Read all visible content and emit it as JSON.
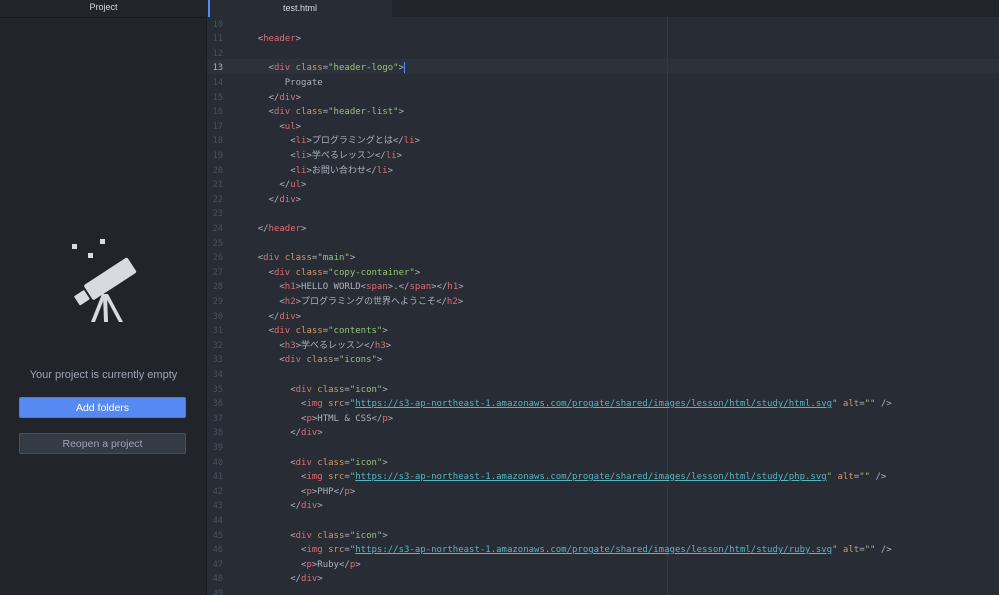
{
  "sidebar": {
    "title": "Project",
    "empty_message": "Your project is currently empty",
    "add_folders_label": "Add folders",
    "reopen_label": "Reopen a project"
  },
  "tabs": [
    {
      "label": "test.html",
      "active": true
    }
  ],
  "editor": {
    "cursor_line": 13,
    "lines": [
      {
        "n": "10",
        "tokens": []
      },
      {
        "n": "11",
        "tokens": [
          {
            "t": "x",
            "v": "    "
          },
          {
            "t": "p",
            "v": "<"
          },
          {
            "t": "t",
            "v": "header"
          },
          {
            "t": "p",
            "v": ">"
          }
        ]
      },
      {
        "n": "12",
        "tokens": []
      },
      {
        "n": "13",
        "tokens": [
          {
            "t": "x",
            "v": "      "
          },
          {
            "t": "p",
            "v": "<"
          },
          {
            "t": "t",
            "v": "div"
          },
          {
            "t": "x",
            "v": " "
          },
          {
            "t": "a",
            "v": "class"
          },
          {
            "t": "p",
            "v": "="
          },
          {
            "t": "s",
            "v": "\"header-logo\""
          },
          {
            "t": "p",
            "v": ">"
          }
        ]
      },
      {
        "n": "14",
        "tokens": [
          {
            "t": "x",
            "v": "         Progate"
          }
        ]
      },
      {
        "n": "15",
        "tokens": [
          {
            "t": "x",
            "v": "      "
          },
          {
            "t": "p",
            "v": "</"
          },
          {
            "t": "t",
            "v": "div"
          },
          {
            "t": "p",
            "v": ">"
          }
        ]
      },
      {
        "n": "16",
        "tokens": [
          {
            "t": "x",
            "v": "      "
          },
          {
            "t": "p",
            "v": "<"
          },
          {
            "t": "t",
            "v": "div"
          },
          {
            "t": "x",
            "v": " "
          },
          {
            "t": "a",
            "v": "class"
          },
          {
            "t": "p",
            "v": "="
          },
          {
            "t": "s",
            "v": "\"header-list\""
          },
          {
            "t": "p",
            "v": ">"
          }
        ]
      },
      {
        "n": "17",
        "tokens": [
          {
            "t": "x",
            "v": "        "
          },
          {
            "t": "p",
            "v": "<"
          },
          {
            "t": "t",
            "v": "ul"
          },
          {
            "t": "p",
            "v": ">"
          }
        ]
      },
      {
        "n": "18",
        "tokens": [
          {
            "t": "x",
            "v": "          "
          },
          {
            "t": "p",
            "v": "<"
          },
          {
            "t": "t",
            "v": "li"
          },
          {
            "t": "p",
            "v": ">"
          },
          {
            "t": "x",
            "v": "プログラミングとは"
          },
          {
            "t": "p",
            "v": "</"
          },
          {
            "t": "t",
            "v": "li"
          },
          {
            "t": "p",
            "v": ">"
          }
        ]
      },
      {
        "n": "19",
        "tokens": [
          {
            "t": "x",
            "v": "          "
          },
          {
            "t": "p",
            "v": "<"
          },
          {
            "t": "t",
            "v": "li"
          },
          {
            "t": "p",
            "v": ">"
          },
          {
            "t": "x",
            "v": "学べるレッスン"
          },
          {
            "t": "p",
            "v": "</"
          },
          {
            "t": "t",
            "v": "li"
          },
          {
            "t": "p",
            "v": ">"
          }
        ]
      },
      {
        "n": "20",
        "tokens": [
          {
            "t": "x",
            "v": "          "
          },
          {
            "t": "p",
            "v": "<"
          },
          {
            "t": "t",
            "v": "li"
          },
          {
            "t": "p",
            "v": ">"
          },
          {
            "t": "x",
            "v": "お問い合わせ"
          },
          {
            "t": "p",
            "v": "</"
          },
          {
            "t": "t",
            "v": "li"
          },
          {
            "t": "p",
            "v": ">"
          }
        ]
      },
      {
        "n": "21",
        "tokens": [
          {
            "t": "x",
            "v": "        "
          },
          {
            "t": "p",
            "v": "</"
          },
          {
            "t": "t",
            "v": "ul"
          },
          {
            "t": "p",
            "v": ">"
          }
        ]
      },
      {
        "n": "22",
        "tokens": [
          {
            "t": "x",
            "v": "      "
          },
          {
            "t": "p",
            "v": "</"
          },
          {
            "t": "t",
            "v": "div"
          },
          {
            "t": "p",
            "v": ">"
          }
        ]
      },
      {
        "n": "23",
        "tokens": []
      },
      {
        "n": "24",
        "tokens": [
          {
            "t": "x",
            "v": "    "
          },
          {
            "t": "p",
            "v": "</"
          },
          {
            "t": "t",
            "v": "header"
          },
          {
            "t": "p",
            "v": ">"
          }
        ]
      },
      {
        "n": "25",
        "tokens": []
      },
      {
        "n": "26",
        "tokens": [
          {
            "t": "x",
            "v": "    "
          },
          {
            "t": "p",
            "v": "<"
          },
          {
            "t": "t",
            "v": "div"
          },
          {
            "t": "x",
            "v": " "
          },
          {
            "t": "a",
            "v": "class"
          },
          {
            "t": "p",
            "v": "="
          },
          {
            "t": "s",
            "v": "\"main\""
          },
          {
            "t": "p",
            "v": ">"
          }
        ]
      },
      {
        "n": "27",
        "tokens": [
          {
            "t": "x",
            "v": "      "
          },
          {
            "t": "p",
            "v": "<"
          },
          {
            "t": "t",
            "v": "div"
          },
          {
            "t": "x",
            "v": " "
          },
          {
            "t": "a",
            "v": "class"
          },
          {
            "t": "p",
            "v": "="
          },
          {
            "t": "s",
            "v": "\"copy-container\""
          },
          {
            "t": "p",
            "v": ">"
          }
        ]
      },
      {
        "n": "28",
        "tokens": [
          {
            "t": "x",
            "v": "        "
          },
          {
            "t": "p",
            "v": "<"
          },
          {
            "t": "t",
            "v": "h1"
          },
          {
            "t": "p",
            "v": ">"
          },
          {
            "t": "x",
            "v": "HELLO WORLD"
          },
          {
            "t": "p",
            "v": "<"
          },
          {
            "t": "t",
            "v": "span"
          },
          {
            "t": "p",
            "v": ">"
          },
          {
            "t": "x",
            "v": "."
          },
          {
            "t": "p",
            "v": "</"
          },
          {
            "t": "t",
            "v": "span"
          },
          {
            "t": "p",
            "v": "></"
          },
          {
            "t": "t",
            "v": "h1"
          },
          {
            "t": "p",
            "v": ">"
          }
        ]
      },
      {
        "n": "29",
        "tokens": [
          {
            "t": "x",
            "v": "        "
          },
          {
            "t": "p",
            "v": "<"
          },
          {
            "t": "t",
            "v": "h2"
          },
          {
            "t": "p",
            "v": ">"
          },
          {
            "t": "x",
            "v": "プログラミングの世界へようこそ"
          },
          {
            "t": "p",
            "v": "</"
          },
          {
            "t": "t",
            "v": "h2"
          },
          {
            "t": "p",
            "v": ">"
          }
        ]
      },
      {
        "n": "30",
        "tokens": [
          {
            "t": "x",
            "v": "      "
          },
          {
            "t": "p",
            "v": "</"
          },
          {
            "t": "t",
            "v": "div"
          },
          {
            "t": "p",
            "v": ">"
          }
        ]
      },
      {
        "n": "31",
        "tokens": [
          {
            "t": "x",
            "v": "      "
          },
          {
            "t": "p",
            "v": "<"
          },
          {
            "t": "t",
            "v": "div"
          },
          {
            "t": "x",
            "v": " "
          },
          {
            "t": "a",
            "v": "class"
          },
          {
            "t": "p",
            "v": "="
          },
          {
            "t": "s",
            "v": "\"contents\""
          },
          {
            "t": "p",
            "v": ">"
          }
        ]
      },
      {
        "n": "32",
        "tokens": [
          {
            "t": "x",
            "v": "        "
          },
          {
            "t": "p",
            "v": "<"
          },
          {
            "t": "t",
            "v": "h3"
          },
          {
            "t": "p",
            "v": ">"
          },
          {
            "t": "x",
            "v": "学べるレッスン"
          },
          {
            "t": "p",
            "v": "</"
          },
          {
            "t": "t",
            "v": "h3"
          },
          {
            "t": "p",
            "v": ">"
          }
        ]
      },
      {
        "n": "33",
        "tokens": [
          {
            "t": "x",
            "v": "        "
          },
          {
            "t": "p",
            "v": "<"
          },
          {
            "t": "t",
            "v": "div"
          },
          {
            "t": "x",
            "v": " "
          },
          {
            "t": "a",
            "v": "class"
          },
          {
            "t": "p",
            "v": "="
          },
          {
            "t": "s",
            "v": "\"icons\""
          },
          {
            "t": "p",
            "v": ">"
          }
        ]
      },
      {
        "n": "34",
        "tokens": []
      },
      {
        "n": "35",
        "tokens": [
          {
            "t": "x",
            "v": "          "
          },
          {
            "t": "p",
            "v": "<"
          },
          {
            "t": "t",
            "v": "div"
          },
          {
            "t": "x",
            "v": " "
          },
          {
            "t": "a",
            "v": "class"
          },
          {
            "t": "p",
            "v": "="
          },
          {
            "t": "s",
            "v": "\"icon\""
          },
          {
            "t": "p",
            "v": ">"
          }
        ]
      },
      {
        "n": "36",
        "tokens": [
          {
            "t": "x",
            "v": "            "
          },
          {
            "t": "p",
            "v": "<"
          },
          {
            "t": "t",
            "v": "img"
          },
          {
            "t": "x",
            "v": " "
          },
          {
            "t": "a",
            "v": "src"
          },
          {
            "t": "p",
            "v": "="
          },
          {
            "t": "s",
            "v": "\""
          },
          {
            "t": "u",
            "v": "https://s3-ap-northeast-1.amazonaws.com/progate/shared/images/lesson/html/study/html.svg"
          },
          {
            "t": "s",
            "v": "\""
          },
          {
            "t": "x",
            "v": " "
          },
          {
            "t": "a",
            "v": "alt"
          },
          {
            "t": "p",
            "v": "="
          },
          {
            "t": "s",
            "v": "\"\""
          },
          {
            "t": "x",
            "v": " "
          },
          {
            "t": "p",
            "v": "/>"
          }
        ]
      },
      {
        "n": "37",
        "tokens": [
          {
            "t": "x",
            "v": "            "
          },
          {
            "t": "p",
            "v": "<"
          },
          {
            "t": "t",
            "v": "p"
          },
          {
            "t": "p",
            "v": ">"
          },
          {
            "t": "x",
            "v": "HTML & CSS"
          },
          {
            "t": "p",
            "v": "</"
          },
          {
            "t": "t",
            "v": "p"
          },
          {
            "t": "p",
            "v": ">"
          }
        ]
      },
      {
        "n": "38",
        "tokens": [
          {
            "t": "x",
            "v": "          "
          },
          {
            "t": "p",
            "v": "</"
          },
          {
            "t": "t",
            "v": "div"
          },
          {
            "t": "p",
            "v": ">"
          }
        ]
      },
      {
        "n": "39",
        "tokens": []
      },
      {
        "n": "40",
        "tokens": [
          {
            "t": "x",
            "v": "          "
          },
          {
            "t": "p",
            "v": "<"
          },
          {
            "t": "t",
            "v": "div"
          },
          {
            "t": "x",
            "v": " "
          },
          {
            "t": "a",
            "v": "class"
          },
          {
            "t": "p",
            "v": "="
          },
          {
            "t": "s",
            "v": "\"icon\""
          },
          {
            "t": "p",
            "v": ">"
          }
        ]
      },
      {
        "n": "41",
        "tokens": [
          {
            "t": "x",
            "v": "            "
          },
          {
            "t": "p",
            "v": "<"
          },
          {
            "t": "t",
            "v": "img"
          },
          {
            "t": "x",
            "v": " "
          },
          {
            "t": "a",
            "v": "src"
          },
          {
            "t": "p",
            "v": "="
          },
          {
            "t": "s",
            "v": "\""
          },
          {
            "t": "u",
            "v": "https://s3-ap-northeast-1.amazonaws.com/progate/shared/images/lesson/html/study/php.svg"
          },
          {
            "t": "s",
            "v": "\""
          },
          {
            "t": "x",
            "v": " "
          },
          {
            "t": "a",
            "v": "alt"
          },
          {
            "t": "p",
            "v": "="
          },
          {
            "t": "s",
            "v": "\"\""
          },
          {
            "t": "x",
            "v": " "
          },
          {
            "t": "p",
            "v": "/>"
          }
        ]
      },
      {
        "n": "42",
        "tokens": [
          {
            "t": "x",
            "v": "            "
          },
          {
            "t": "p",
            "v": "<"
          },
          {
            "t": "t",
            "v": "p"
          },
          {
            "t": "p",
            "v": ">"
          },
          {
            "t": "x",
            "v": "PHP"
          },
          {
            "t": "p",
            "v": "</"
          },
          {
            "t": "t",
            "v": "p"
          },
          {
            "t": "p",
            "v": ">"
          }
        ]
      },
      {
        "n": "43",
        "tokens": [
          {
            "t": "x",
            "v": "          "
          },
          {
            "t": "p",
            "v": "</"
          },
          {
            "t": "t",
            "v": "div"
          },
          {
            "t": "p",
            "v": ">"
          }
        ]
      },
      {
        "n": "44",
        "tokens": []
      },
      {
        "n": "45",
        "tokens": [
          {
            "t": "x",
            "v": "          "
          },
          {
            "t": "p",
            "v": "<"
          },
          {
            "t": "t",
            "v": "div"
          },
          {
            "t": "x",
            "v": " "
          },
          {
            "t": "a",
            "v": "class"
          },
          {
            "t": "p",
            "v": "="
          },
          {
            "t": "s",
            "v": "\"icon\""
          },
          {
            "t": "p",
            "v": ">"
          }
        ]
      },
      {
        "n": "46",
        "tokens": [
          {
            "t": "x",
            "v": "            "
          },
          {
            "t": "p",
            "v": "<"
          },
          {
            "t": "t",
            "v": "img"
          },
          {
            "t": "x",
            "v": " "
          },
          {
            "t": "a",
            "v": "src"
          },
          {
            "t": "p",
            "v": "="
          },
          {
            "t": "s",
            "v": "\""
          },
          {
            "t": "u",
            "v": "https://s3-ap-northeast-1.amazonaws.com/progate/shared/images/lesson/html/study/ruby.svg"
          },
          {
            "t": "s",
            "v": "\""
          },
          {
            "t": "x",
            "v": " "
          },
          {
            "t": "a",
            "v": "alt"
          },
          {
            "t": "p",
            "v": "="
          },
          {
            "t": "s",
            "v": "\"\""
          },
          {
            "t": "x",
            "v": " "
          },
          {
            "t": "p",
            "v": "/>"
          }
        ]
      },
      {
        "n": "47",
        "tokens": [
          {
            "t": "x",
            "v": "            "
          },
          {
            "t": "p",
            "v": "<"
          },
          {
            "t": "t",
            "v": "p"
          },
          {
            "t": "p",
            "v": ">"
          },
          {
            "t": "x",
            "v": "Ruby"
          },
          {
            "t": "p",
            "v": "</"
          },
          {
            "t": "t",
            "v": "p"
          },
          {
            "t": "p",
            "v": ">"
          }
        ]
      },
      {
        "n": "48",
        "tokens": [
          {
            "t": "x",
            "v": "          "
          },
          {
            "t": "p",
            "v": "</"
          },
          {
            "t": "t",
            "v": "div"
          },
          {
            "t": "p",
            "v": ">"
          }
        ]
      },
      {
        "n": "49",
        "tokens": []
      }
    ]
  },
  "colors": {
    "accent": "#568af2",
    "tag": "#e06c75",
    "attribute": "#d19a66",
    "string": "#98c379",
    "url": "#56b6c2"
  },
  "icons": {
    "empty_project": "telescope-icon"
  }
}
